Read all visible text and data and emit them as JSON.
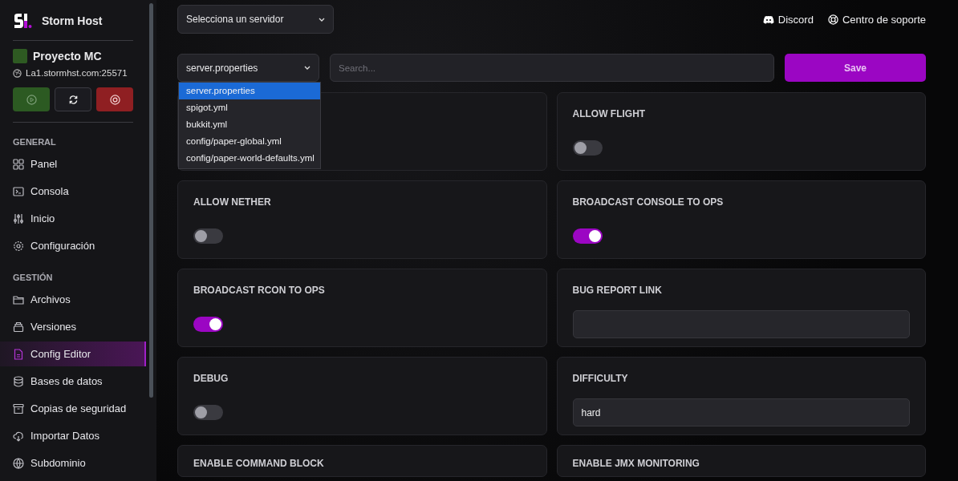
{
  "sidebar": {
    "brand": "Storm Host",
    "project": {
      "name": "Proyecto MC",
      "address": "La1.stormhst.com:25571"
    },
    "power_buttons": [
      {
        "kind": "start"
      },
      {
        "kind": "restart"
      },
      {
        "kind": "stop"
      }
    ],
    "sections": [
      {
        "heading": "GENERAL",
        "items": [
          {
            "label": "Panel",
            "kind": "grid",
            "selected": false
          },
          {
            "label": "Consola",
            "kind": "terminal",
            "selected": false
          },
          {
            "label": "Inicio",
            "kind": "sliders",
            "selected": false
          },
          {
            "label": "Configuración",
            "kind": "gear",
            "selected": false
          }
        ]
      },
      {
        "heading": "GESTIÓN",
        "items": [
          {
            "label": "Archivos",
            "kind": "folder",
            "selected": false
          },
          {
            "label": "Versiones",
            "kind": "stack",
            "selected": false
          },
          {
            "label": "Config Editor",
            "kind": "file",
            "selected": true
          },
          {
            "label": "Bases de datos",
            "kind": "database",
            "selected": false
          },
          {
            "label": "Copias de seguridad",
            "kind": "archive",
            "selected": false
          },
          {
            "label": "Importar Datos",
            "kind": "cloud",
            "selected": false
          },
          {
            "label": "Subdominio",
            "kind": "globe",
            "selected": false
          }
        ]
      }
    ]
  },
  "server_select": {
    "value": "Selecciona un servidor"
  },
  "header_links": [
    {
      "label": "Discord",
      "kind": "discord"
    },
    {
      "label": "Centro de soporte",
      "kind": "support"
    }
  ],
  "file_select": {
    "value": "server.properties",
    "expanded": true,
    "options": [
      {
        "label": "server.properties",
        "selected": true
      },
      {
        "label": "spigot.yml",
        "selected": false
      },
      {
        "label": "bukkit.yml",
        "selected": false
      },
      {
        "label": "config/paper-global.yml",
        "selected": false
      },
      {
        "label": "config/paper-world-defaults.yml",
        "selected": false
      }
    ]
  },
  "search": {
    "placeholder": "Search..."
  },
  "save_button": "Save",
  "settings": [
    {
      "kind": "covered"
    },
    {
      "kind": "toggle",
      "title": "ALLOW FLIGHT",
      "on": false
    },
    {
      "kind": "toggle",
      "title": "ALLOW NETHER",
      "on": false
    },
    {
      "kind": "toggle",
      "title": "BROADCAST CONSOLE TO OPS",
      "on": true
    },
    {
      "kind": "toggle",
      "title": "BROADCAST RCON TO OPS",
      "on": true
    },
    {
      "kind": "text",
      "title": "BUG REPORT LINK"
    },
    {
      "kind": "toggle",
      "title": "DEBUG",
      "on": false
    },
    {
      "kind": "text",
      "title": "DIFFICULTY",
      "value": "hard"
    },
    {
      "kind": "cut",
      "title": "ENABLE COMMAND BLOCK"
    },
    {
      "kind": "cut",
      "title": "ENABLE JMX MONITORING"
    }
  ]
}
